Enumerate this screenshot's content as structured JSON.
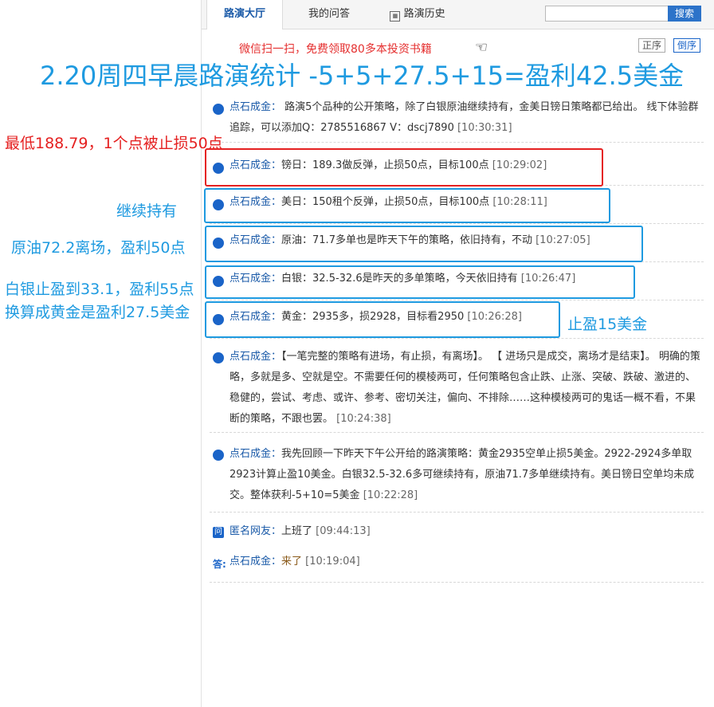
{
  "tabs": [
    "路演大厅",
    "我的问答",
    "路演历史"
  ],
  "search": {
    "placeholder": "",
    "button": "搜索"
  },
  "promo": "微信扫一扫，免费领取80多本投资书籍",
  "order": {
    "asc": "正序",
    "desc": "倒序"
  },
  "headline": "2.20周四早晨路演统计    -5+5+27.5+15=盈利42.5美金",
  "messages": [
    {
      "author": "点石成金：",
      "text": "路演5个品种的公开策略，除了白银原油继续持有，金美日镑日策略都已给出。 线下体验群追踪，可以添加Q：2785516867  V：dscj7890",
      "time": "[10:30:31]"
    },
    {
      "author": "点石成金：",
      "text": "镑日：189.3做反弹，止损50点，目标100点",
      "time": "[10:29:02]"
    },
    {
      "author": "点石成金：",
      "text": "美日：150租个反弹，止损50点，目标100点",
      "time": "[10:28:11]"
    },
    {
      "author": "点石成金：",
      "text": "原油：71.7多单也是昨天下午的策略，依旧持有，不动",
      "time": "[10:27:05]"
    },
    {
      "author": "点石成金：",
      "text": "白银：32.5-32.6是昨天的多单策略，今天依旧持有",
      "time": "[10:26:47]"
    },
    {
      "author": "点石成金：",
      "text": "黄金：2935多，损2928，目标看2950",
      "time": "[10:26:28]"
    },
    {
      "author": "点石成金：",
      "text": "【一笔完整的策略有进场，有止损，有离场】。 【 进场只是成交，离场才是结束】。 明确的策略，多就是多、空就是空。不需要任何的模棱两可，任何策略包含止跌、止涨、突破、跌破、激进的、稳健的，尝试、考虑、或许、参考、密切关注，偏向、不排除……这种模棱两可的鬼话一概不看，不果断的策略，不跟也罢。",
      "time": "[10:24:38]"
    },
    {
      "author": "点石成金：",
      "text": "我先回顾一下昨天下午公开给的路演策略：黄金2935空单止损5美金。2922-2924多单取2923计算止盈10美金。白银32.5-32.6多可继续持有，原油71.7多单继续持有。美日镑日空单均未成交。整体获利-5+10=5美金",
      "time": "[10:22:28]"
    }
  ],
  "question": {
    "icon": "问",
    "author": "匿名网友：",
    "text": "上班了",
    "time": "[09:44:13]"
  },
  "answer": {
    "icon": "答:",
    "author": "点石成金：",
    "text": "来了",
    "time": "[10:19:04]"
  },
  "annotations": {
    "low": "最低188.79，1个点被止损50点",
    "hold": "继续持有",
    "oil": "原油72.2离场，盈利50点",
    "silver1": "白银止盈到33.1，盈利55点",
    "silver2": "换算成黄金是盈利27.5美金",
    "gold": "止盈15美金"
  },
  "colors": {
    "accent": "#1e9ae0",
    "alert": "#e52020"
  }
}
